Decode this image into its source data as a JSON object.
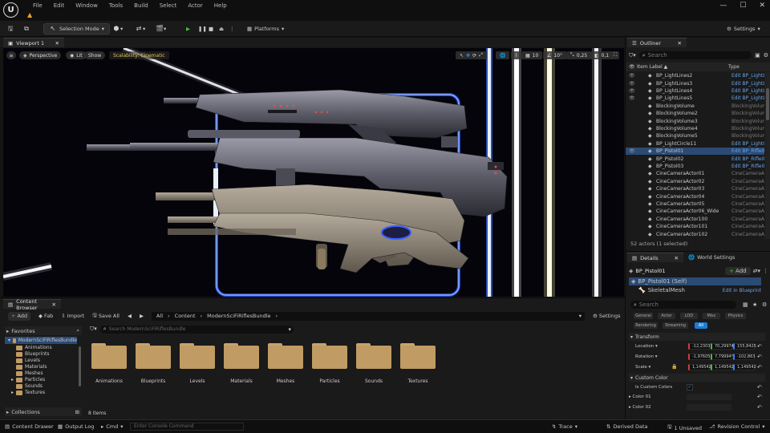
{
  "menu": [
    "File",
    "Edit",
    "Window",
    "Tools",
    "Build",
    "Select",
    "Actor",
    "Help"
  ],
  "toolbar": {
    "selection_mode": "Selection Mode",
    "platforms": "Platforms",
    "settings": "Settings"
  },
  "viewport": {
    "tab": "Viewport 1",
    "perspective": "Perspective",
    "lit": "Lit",
    "show": "Show",
    "scalability": "Scalability: Cinematic",
    "grid_snap": "10",
    "rot_snap": "10°",
    "scale_snap": "0,25",
    "cam_speed": "0,1",
    "camera_badge": "4"
  },
  "outliner": {
    "title": "Outliner",
    "search_placeholder": "Search",
    "col_label": "Item Label ▲",
    "col_type": "Type",
    "rows": [
      {
        "name": "BP_LightLines2",
        "type": "Edit BP_LightL"
      },
      {
        "name": "BP_LightLines3",
        "type": "Edit BP_LightL"
      },
      {
        "name": "BP_LightLines4",
        "type": "Edit BP_LightL"
      },
      {
        "name": "BP_LightLines5",
        "type": "Edit BP_LightL"
      },
      {
        "name": "BlockingVolume",
        "type": "BlockingVolume"
      },
      {
        "name": "BlockingVolume2",
        "type": "BlockingVolume"
      },
      {
        "name": "BlockingVolume3",
        "type": "BlockingVolume"
      },
      {
        "name": "BlockingVolume4",
        "type": "BlockingVolume"
      },
      {
        "name": "BlockingVolume5",
        "type": "BlockingVolume"
      },
      {
        "name": "BP_LightCircle11",
        "type": "Edit BP_LightC"
      },
      {
        "name": "BP_Pistol01",
        "type": "Edit BP_Rifle0"
      },
      {
        "name": "BP_Pistol02",
        "type": "Edit BP_Rifle0"
      },
      {
        "name": "BP_Pistol03",
        "type": "Edit BP_Rifle0"
      },
      {
        "name": "CineCameraActor01",
        "type": "CineCameraAc"
      },
      {
        "name": "CineCameraActor02",
        "type": "CineCameraAc"
      },
      {
        "name": "CineCameraActor03",
        "type": "CineCameraAc"
      },
      {
        "name": "CineCameraActor04",
        "type": "CineCameraAc"
      },
      {
        "name": "CineCameraActor05",
        "type": "CineCameraAc"
      },
      {
        "name": "CineCameraActor06_Wide",
        "type": "CineCameraAc"
      },
      {
        "name": "CineCameraActor100",
        "type": "CineCameraAc"
      },
      {
        "name": "CineCameraActor101",
        "type": "CineCameraAc"
      },
      {
        "name": "CineCameraActor102",
        "type": "CineCameraAc"
      }
    ],
    "footer": "52 actors (1 selected)"
  },
  "details": {
    "tab": "Details",
    "tab2": "World Settings",
    "actor": "BP_Pistol01",
    "add": "Add",
    "self": "BP_Pistol01 (Self)",
    "skeletal": "SkeletalMesh",
    "edit_bp": "Edit in Blueprint",
    "search_placeholder": "Search",
    "filters": [
      "General",
      "Actor",
      "LOD",
      "Misc",
      "Physics",
      "Rendering",
      "Streaming",
      "All"
    ],
    "transform": "Transform",
    "location": {
      "label": "Location",
      "x": "-12,2303",
      "y": "70,29974",
      "z": "155,8425"
    },
    "rotation": {
      "label": "Rotation",
      "x": "-1,97605",
      "y": "7,79994°",
      "z": "-102,863"
    },
    "scale": {
      "label": "Scale",
      "x": "1,149542",
      "y": "1,149542",
      "z": "1,149542"
    },
    "custom_color": "Custom Color",
    "is_custom": "Is Custom Colors",
    "color1": "Color 01",
    "color2": "Color 02"
  },
  "content_browser": {
    "tab": "Content Browser",
    "add": "Add",
    "fab": "Fab",
    "import": "Import",
    "save_all": "Save All",
    "path": [
      "All",
      "Content",
      "ModernSciFiRiflesBundle"
    ],
    "settings": "Settings",
    "favorites": "Favorites",
    "root": "ModernSciFiRiflesBundle",
    "tree": [
      "Animations",
      "Blueprints",
      "Levels",
      "Materials",
      "Meshes",
      "Particles",
      "Sounds",
      "Textures"
    ],
    "collections": "Collections",
    "search_placeholder": "Search ModernSciFiRiflesBundle",
    "folders": [
      "Animations",
      "Blueprints",
      "Levels",
      "Materials",
      "Meshes",
      "Particles",
      "Sounds",
      "Textures"
    ],
    "count": "8 items"
  },
  "statusbar": {
    "content_drawer": "Content Drawer",
    "output_log": "Output Log",
    "cmd": "Cmd",
    "console_placeholder": "Enter Console Command",
    "trace": "Trace",
    "derived": "Derived Data",
    "unsaved": "1 Unsaved",
    "revision": "Revision Control"
  }
}
